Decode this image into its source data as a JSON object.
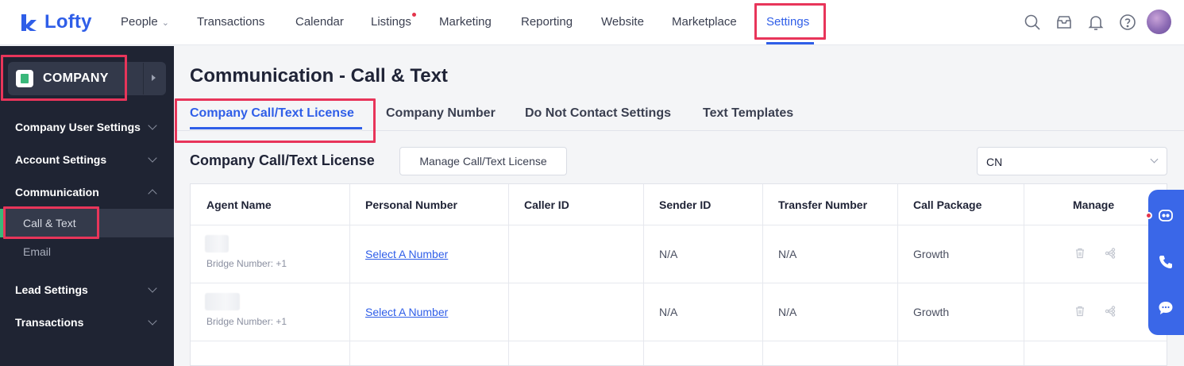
{
  "brand": {
    "name": "Lofty",
    "color": "#2f5ee8"
  },
  "nav": {
    "items": [
      {
        "label": "People",
        "has_dropdown": true
      },
      {
        "label": "Transactions"
      },
      {
        "label": "Calendar"
      },
      {
        "label": "Listings",
        "has_dot": true
      },
      {
        "label": "Marketing"
      },
      {
        "label": "Reporting"
      },
      {
        "label": "Website"
      },
      {
        "label": "Marketplace"
      },
      {
        "label": "Settings",
        "active": true
      }
    ],
    "icons": [
      "search-icon",
      "inbox-icon",
      "bell-icon",
      "help-icon",
      "avatar"
    ]
  },
  "sidebar": {
    "company_label": "COMPANY",
    "groups": [
      {
        "label": "Company User Settings",
        "expanded": false
      },
      {
        "label": "Account Settings",
        "expanded": false
      },
      {
        "label": "Communication",
        "expanded": true
      },
      {
        "label": "Lead Settings",
        "expanded": false
      },
      {
        "label": "Transactions",
        "expanded": false
      }
    ],
    "communication_items": [
      {
        "label": "Call & Text",
        "active": true
      },
      {
        "label": "Email"
      }
    ]
  },
  "page": {
    "title": "Communication - Call & Text",
    "tabs": [
      {
        "label": "Company Call/Text License",
        "active": true
      },
      {
        "label": "Company Number"
      },
      {
        "label": "Do Not Contact Settings"
      },
      {
        "label": "Text Templates"
      }
    ],
    "section_title": "Company Call/Text License",
    "manage_button": "Manage Call/Text License",
    "country_select": "CN"
  },
  "table": {
    "headers": [
      "Agent Name",
      "Personal Number",
      "Caller ID",
      "Sender ID",
      "Transfer Number",
      "Call Package",
      "Manage"
    ],
    "rows": [
      {
        "bridge": "Bridge Number: +1",
        "personal_number": "Select A Number",
        "caller_id": "",
        "sender_id": "N/A",
        "transfer_number": "N/A",
        "call_package": "Growth"
      },
      {
        "bridge": "Bridge Number: +1",
        "personal_number": "Select A Number",
        "caller_id": "",
        "sender_id": "N/A",
        "transfer_number": "N/A",
        "call_package": "Growth"
      }
    ]
  },
  "floating_widget": {
    "icons": [
      "chatbot-icon",
      "phone-icon",
      "chat-bubble-icon"
    ],
    "color": "#3a67e8"
  },
  "highlight_color": "#e8355a"
}
